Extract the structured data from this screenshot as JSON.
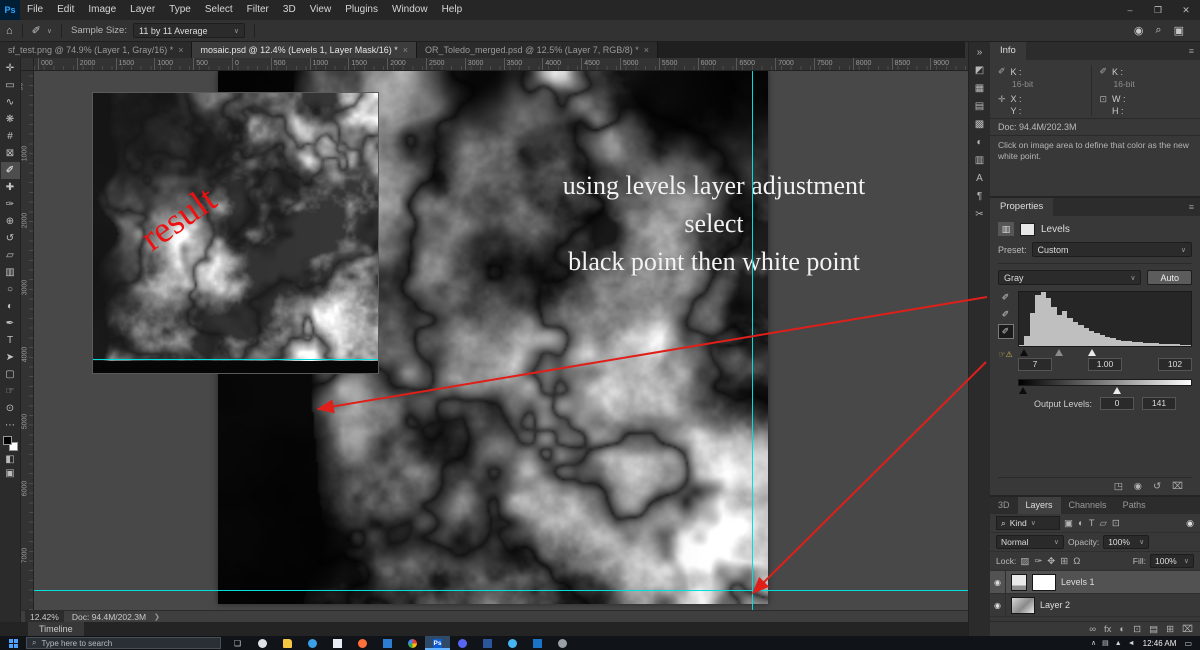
{
  "colors": {
    "accent_blue": "#1473e6",
    "guide_cyan": "#00dede",
    "arrow_red": "#df1f1a",
    "result_red": "#ee1111",
    "annotation_white": "#f2f2f2"
  },
  "ui": {
    "chevron_down": "∨",
    "menu_icon": "≡"
  },
  "titlebar": {
    "logo": "Ps",
    "menus": [
      "File",
      "Edit",
      "Image",
      "Layer",
      "Type",
      "Select",
      "Filter",
      "3D",
      "View",
      "Plugins",
      "Window",
      "Help"
    ],
    "window": {
      "minimize": "–",
      "restore": "❐",
      "close": "✕"
    }
  },
  "optionsbar": {
    "home_icon": "⌂",
    "tool_icon": "✐",
    "sample_size_label": "Sample Size:",
    "sample_size_value": "11 by 11 Average",
    "right_icons": [
      {
        "name": "share-icon",
        "glyph": "◉"
      },
      {
        "name": "search-icon",
        "glyph": "⌕"
      },
      {
        "name": "workspace-icon",
        "glyph": "▣"
      }
    ]
  },
  "tabs": [
    {
      "label": "sf_test.png @ 74.9% (Layer 1, Gray/16) *",
      "close": "×",
      "active": false
    },
    {
      "label": "mosaic.psd @ 12.4% (Levels 1, Layer Mask/16) *",
      "close": "×",
      "active": true
    },
    {
      "label": "OR_Toledo_merged.psd @ 12.5% (Layer 7, RGB/8) *",
      "close": "×",
      "active": false
    }
  ],
  "rulers": {
    "horizontal": [
      "000",
      "2000",
      "1500",
      "1000",
      "500",
      "0",
      "500",
      "1000",
      "1500",
      "2000",
      "2500",
      "3000",
      "3500",
      "4000",
      "4500",
      "5000",
      "5500",
      "6000",
      "6500",
      "7000",
      "7500",
      "8000",
      "8500",
      "9000"
    ],
    "vertical": [
      "00",
      "1000",
      "2000",
      "3000",
      "4000",
      "5000",
      "6000",
      "7000"
    ]
  },
  "toolbar": {
    "tools": [
      {
        "name": "move-tool",
        "glyph": "✛"
      },
      {
        "name": "marquee-tool",
        "glyph": "▭"
      },
      {
        "name": "lasso-tool",
        "glyph": "∿"
      },
      {
        "name": "quick-selection-tool",
        "glyph": "❋"
      },
      {
        "name": "crop-tool",
        "glyph": "#"
      },
      {
        "name": "frame-tool",
        "glyph": "⊠"
      },
      {
        "name": "eyedropper-tool",
        "glyph": "✐",
        "selected": true
      },
      {
        "name": "healing-brush-tool",
        "glyph": "✚"
      },
      {
        "name": "brush-tool",
        "glyph": "✑"
      },
      {
        "name": "clone-stamp-tool",
        "glyph": "⊕"
      },
      {
        "name": "history-brush-tool",
        "glyph": "↺"
      },
      {
        "name": "eraser-tool",
        "glyph": "▱"
      },
      {
        "name": "gradient-tool",
        "glyph": "▥"
      },
      {
        "name": "blur-tool",
        "glyph": "○"
      },
      {
        "name": "dodge-tool",
        "glyph": "◐"
      },
      {
        "name": "pen-tool",
        "glyph": "✒"
      },
      {
        "name": "type-tool",
        "glyph": "T"
      },
      {
        "name": "path-select-tool",
        "glyph": "➤"
      },
      {
        "name": "shape-tool",
        "glyph": "▢"
      },
      {
        "name": "hand-tool",
        "glyph": "☞"
      },
      {
        "name": "zoom-tool",
        "glyph": "⊙"
      }
    ],
    "edit_toolbar_icon": "⋯"
  },
  "canvas": {
    "annotation_lines": [
      "using levels layer adjustment",
      "select",
      "black point then white point"
    ],
    "inset_label": "result"
  },
  "panel_strip": {
    "icons": [
      {
        "name": "collapse-panels-icon",
        "glyph": "»"
      },
      {
        "name": "color-panel-icon",
        "glyph": "◩"
      },
      {
        "name": "swatches-panel-icon",
        "glyph": "▦"
      },
      {
        "name": "gradients-panel-icon",
        "glyph": "▤"
      },
      {
        "name": "patterns-panel-icon",
        "glyph": "▩"
      },
      {
        "name": "adjustments-panel-icon",
        "glyph": "◐"
      },
      {
        "name": "libraries-panel-icon",
        "glyph": "▥"
      },
      {
        "name": "character-panel-icon",
        "glyph": "A"
      },
      {
        "name": "paragraph-panel-icon",
        "glyph": "¶"
      },
      {
        "name": "clone-source-panel-icon",
        "glyph": "✂"
      }
    ]
  },
  "info_panel": {
    "tab": "Info",
    "left": {
      "icon": "✐",
      "channel": "K :",
      "bits": "16-bit"
    },
    "right": {
      "icon": "✐",
      "channel": "K :",
      "bits": "16-bit"
    },
    "pos": {
      "icon": "✛",
      "x_label": "X :",
      "y_label": "Y :"
    },
    "size": {
      "icon": "⊡",
      "w_label": "W :",
      "h_label": "H :"
    },
    "doc": "Doc: 94.4M/202.3M",
    "hint": "Click on image area to define that color as the new white point."
  },
  "properties_panel": {
    "tab": "Properties",
    "adjustment_icon": "▥",
    "title": "Levels",
    "preset_label": "Preset:",
    "preset_value": "Custom",
    "channel_value": "Gray",
    "auto_label": "Auto",
    "eyedroppers": [
      {
        "name": "black-point-eyedropper",
        "glyph": "✐"
      },
      {
        "name": "gray-point-eyedropper",
        "glyph": "✐"
      },
      {
        "name": "white-point-eyedropper",
        "glyph": "✐",
        "selected": true
      }
    ],
    "hand_icon": "☞",
    "warning_icon": "⚠",
    "histogram": [
      2,
      18,
      62,
      95,
      100,
      88,
      72,
      58,
      64,
      52,
      44,
      38,
      33,
      28,
      24,
      20,
      17,
      14,
      12,
      10,
      9,
      8,
      7,
      6,
      5,
      5,
      4,
      4,
      3,
      3,
      2,
      2
    ],
    "input_black": "7",
    "input_gamma": "1.00",
    "input_white": "102",
    "output_label": "Output Levels:",
    "output_black": "0",
    "output_white": "141",
    "slider_positions": {
      "input_black_pct": 2,
      "input_gamma_pct": 22,
      "input_white_pct": 41,
      "output_black_pct": 1,
      "output_white_pct": 55
    },
    "footer_icons": [
      {
        "name": "clip-to-layer-icon",
        "glyph": "◳"
      },
      {
        "name": "visibility-icon",
        "glyph": "◉"
      },
      {
        "name": "reset-icon",
        "glyph": "↺"
      },
      {
        "name": "delete-icon",
        "glyph": "⌧"
      }
    ]
  },
  "layers_panel": {
    "tabs": [
      {
        "label": "3D",
        "active": false
      },
      {
        "label": "Layers",
        "active": true
      },
      {
        "label": "Channels",
        "active": false
      },
      {
        "label": "Paths",
        "active": false
      }
    ],
    "filter": {
      "search_icon": "⌕",
      "kind_label": "Kind",
      "type_icons": [
        {
          "name": "pixel-layer-filter-icon",
          "glyph": "▣"
        },
        {
          "name": "adjustment-layer-filter-icon",
          "glyph": "◐"
        },
        {
          "name": "type-layer-filter-icon",
          "glyph": "T"
        },
        {
          "name": "shape-layer-filter-icon",
          "glyph": "▱"
        },
        {
          "name": "smart-object-filter-icon",
          "glyph": "⊡"
        }
      ],
      "toggle_icon": "◉"
    },
    "blend_mode": "Normal",
    "opacity_label": "Opacity:",
    "opacity_value": "100%",
    "lock_label": "Lock:",
    "lock_icons": [
      {
        "name": "lock-transparency-icon",
        "glyph": "▨"
      },
      {
        "name": "lock-pixels-icon",
        "glyph": "✑"
      },
      {
        "name": "lock-position-icon",
        "glyph": "✥"
      },
      {
        "name": "lock-artboard-icon",
        "glyph": "⊞"
      },
      {
        "name": "lock-all-icon",
        "glyph": "Ω"
      }
    ],
    "fill_label": "Fill:",
    "fill_value": "100%",
    "rows": [
      {
        "name": "Levels 1",
        "type": "adjustment",
        "eye": "◉",
        "selected": true
      },
      {
        "name": "Layer 2",
        "type": "image",
        "eye": "◉",
        "selected": false
      }
    ],
    "footer_icons": [
      {
        "name": "link-layers-icon",
        "glyph": "∞"
      },
      {
        "name": "layer-effects-icon",
        "glyph": "fx"
      },
      {
        "name": "adjustment-layer-icon",
        "glyph": "◐"
      },
      {
        "name": "layer-mask-icon",
        "glyph": "⊡"
      },
      {
        "name": "layer-group-icon",
        "glyph": "▤"
      },
      {
        "name": "new-layer-icon",
        "glyph": "⊞"
      },
      {
        "name": "delete-layer-icon",
        "glyph": "⌧"
      }
    ]
  },
  "statusbar": {
    "zoom": "12.42%",
    "doc": "Doc: 94.4M/202.3M",
    "chevron": "❯"
  },
  "timeline": {
    "tab": "Timeline"
  },
  "taskbar": {
    "search_icon": "⌕",
    "search_placeholder": "Type here to search",
    "apps": [
      {
        "name": "task-view-button",
        "shape": "glyph",
        "label": "❏"
      },
      {
        "name": "app-icon-1",
        "shape": "circle",
        "color": "#dfe3e8"
      },
      {
        "name": "file-explorer-icon",
        "shape": "folder",
        "color": "#f7c744"
      },
      {
        "name": "app-icon-2",
        "shape": "circle",
        "color": "#3aa0e8"
      },
      {
        "name": "app-icon-3",
        "shape": "square",
        "color": "#e8eef4"
      },
      {
        "name": "firefox-icon",
        "shape": "circle",
        "color": "#ff7139"
      },
      {
        "name": "app-icon-4",
        "shape": "square",
        "color": "#2d7dd2"
      },
      {
        "name": "chrome-icon",
        "shape": "chrome circle"
      },
      {
        "name": "photoshop-icon",
        "shape": "square",
        "color": "#0f5bd0",
        "label": "Ps",
        "active": true
      },
      {
        "name": "app-icon-5",
        "shape": "circle",
        "color": "#5865f2"
      },
      {
        "name": "app-icon-6",
        "shape": "square",
        "color": "#2b579a"
      },
      {
        "name": "app-icon-7",
        "shape": "circle",
        "color": "#45b6f2"
      },
      {
        "name": "app-icon-8",
        "shape": "square",
        "color": "#1a73c7"
      },
      {
        "name": "app-icon-9",
        "shape": "circle",
        "color": "#9aa0a6"
      }
    ],
    "tray_icons": [
      {
        "name": "tray-chevron-icon",
        "glyph": "∧"
      },
      {
        "name": "tray-status-icon",
        "glyph": "▤"
      },
      {
        "name": "tray-network-icon",
        "glyph": "▲"
      },
      {
        "name": "tray-volume-icon",
        "glyph": "◄"
      }
    ],
    "tray_time": "12:46 AM",
    "notification_icon": "▭"
  }
}
